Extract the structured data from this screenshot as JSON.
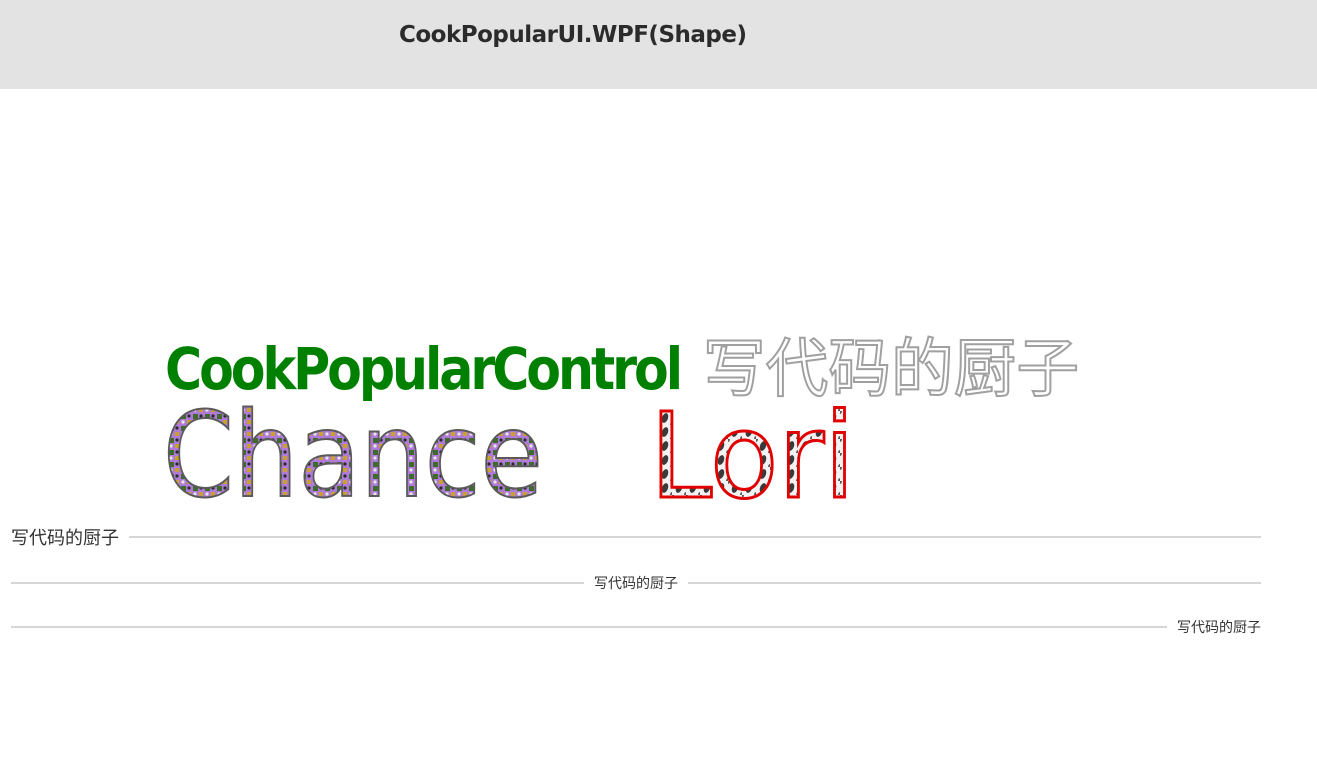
{
  "window": {
    "title": "CookPopularUI.WPF(Shape)"
  },
  "shape_text": {
    "brand": "CookPopularControl",
    "chinese": "写代码的厨子",
    "name1": "Chance",
    "name2": "Lori"
  },
  "dividers": [
    {
      "text": "写代码的厨子",
      "align": "left"
    },
    {
      "text": "写代码的厨子",
      "align": "center"
    },
    {
      "text": "写代码的厨子",
      "align": "right"
    }
  ],
  "colors": {
    "titlebar_bg": "#e3e3e3",
    "brand_fill": "#008000",
    "chinese_stroke": "#a0a0a0",
    "chance_fill": "#b07ad8",
    "chance_stroke": "#5a5a5a",
    "lori_stroke": "#e00000",
    "divider_line": "#d6d6d6"
  }
}
